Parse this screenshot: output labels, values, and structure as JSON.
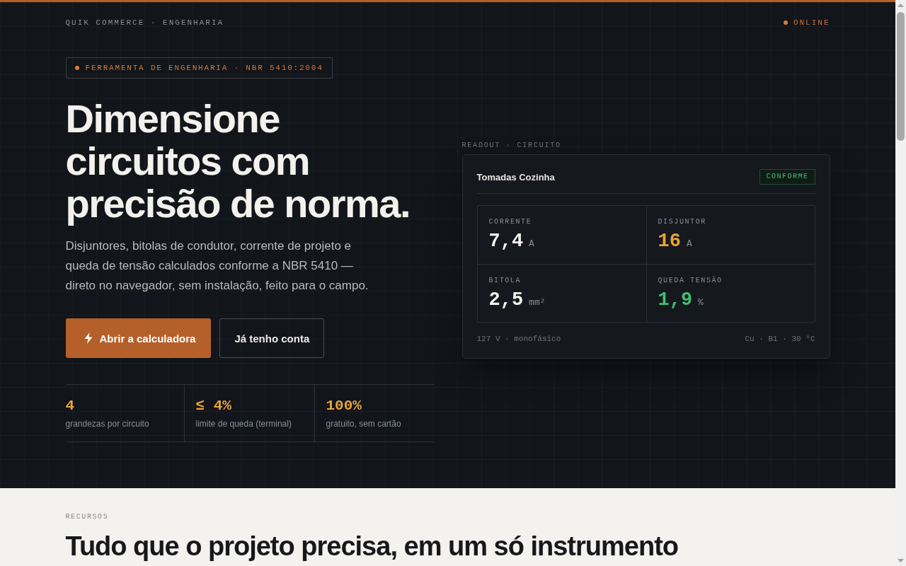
{
  "top_bar": {
    "brand": "QUIK COMMERCE · ENGENHARIA",
    "status": "ONLINE"
  },
  "hero": {
    "badge": "FERRAMENTA DE ENGENHARIA · NBR 5410:2004",
    "title": "Dimensione circuitos com precisão de norma.",
    "description": "Disjuntores, bitolas de condutor, corrente de projeto e queda de tensão calculados conforme a NBR 5410 — direto no navegador, sem instalação, feito para o campo.",
    "buttons": [
      {
        "label": "Abrir a calculadora",
        "kind": "primary"
      },
      {
        "label": "Já tenho conta",
        "kind": "secondary"
      }
    ],
    "stats": [
      {
        "value": "4",
        "label": "grandezas por circuito"
      },
      {
        "value": "≤ 4%",
        "label": "limite de queda (terminal)"
      },
      {
        "value": "100%",
        "label": "gratuito, sem cartão"
      }
    ]
  },
  "readout": {
    "caption": "READOUT · CIRCUITO",
    "card": {
      "title": "Tomadas Cozinha",
      "status": "CONFORME",
      "metrics": [
        {
          "label": "CORRENTE",
          "value": "7,4",
          "unit": "A",
          "color": "#f3f1ec"
        },
        {
          "label": "DISJUNTOR",
          "value": "16",
          "unit": "A",
          "color": "#e8a33d"
        },
        {
          "label": "BITOLA",
          "value": "2,5",
          "unit": "mm²",
          "color": "#f3f1ec"
        },
        {
          "label": "QUEDA TENSÃO",
          "value": "1,9",
          "unit": "%",
          "color": "#3fbf73"
        }
      ],
      "footer_left": "127 V · monofásico",
      "footer_right": "Cu · B1 · 30 °C"
    }
  },
  "features": {
    "eyebrow": "RECURSOS",
    "title": "Tudo que o projeto precisa, em um só instrumento"
  }
}
